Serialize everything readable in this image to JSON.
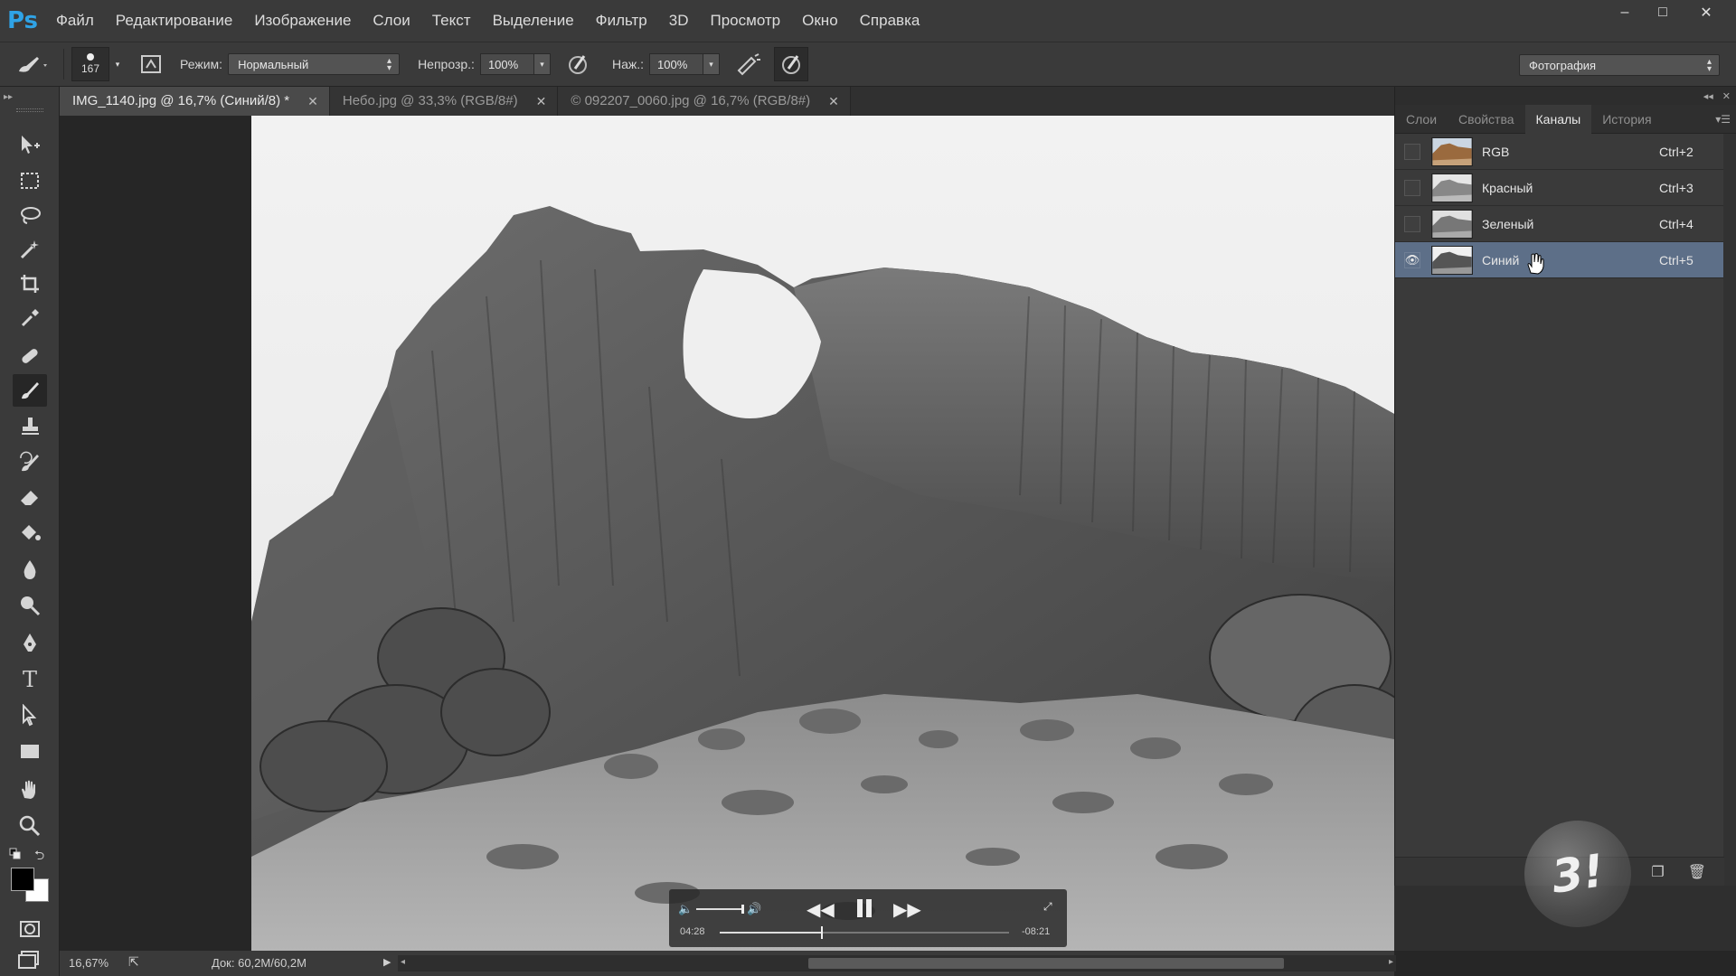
{
  "app": {
    "logo": "Ps"
  },
  "menu": [
    "Файл",
    "Редактирование",
    "Изображение",
    "Слои",
    "Текст",
    "Выделение",
    "Фильтр",
    "3D",
    "Просмотр",
    "Окно",
    "Справка"
  ],
  "window_controls": {
    "minimize": "–",
    "maximize": "□",
    "close": "✕"
  },
  "options": {
    "brush_size": "167",
    "mode_label": "Режим:",
    "mode_value": "Нормальный",
    "opacity_label": "Непрозр.:",
    "opacity_value": "100%",
    "pressure_label": "Наж.:",
    "pressure_value": "100%",
    "workspace": "Фотография"
  },
  "tabs": [
    {
      "label": "IMG_1140.jpg @ 16,7% (Синий/8) *",
      "active": true
    },
    {
      "label": "Небо.jpg @ 33,3% (RGB/8#)",
      "active": false
    },
    {
      "label": "© 092207_0060.jpg @ 16,7% (RGB/8#)",
      "active": false
    }
  ],
  "status": {
    "zoom": "16,67%",
    "doc": "Док: 60,2M/60,2M"
  },
  "panel": {
    "tabs": [
      "Слои",
      "Свойства",
      "Каналы",
      "История"
    ],
    "active_tab": "Каналы",
    "channels": [
      {
        "name": "RGB",
        "shortcut": "Ctrl+2",
        "visible": false,
        "selected": false
      },
      {
        "name": "Красный",
        "shortcut": "Ctrl+3",
        "visible": false,
        "selected": false
      },
      {
        "name": "Зеленый",
        "shortcut": "Ctrl+4",
        "visible": false,
        "selected": false
      },
      {
        "name": "Синий",
        "shortcut": "Ctrl+5",
        "visible": true,
        "selected": true
      }
    ]
  },
  "player": {
    "elapsed": "04:28",
    "remaining": "-08:21",
    "progress": 0.35
  },
  "watermark": "3!",
  "colors": {
    "accent": "#2fa3e6",
    "selection": "#5d6f88",
    "bg": "#3a3a3a"
  }
}
